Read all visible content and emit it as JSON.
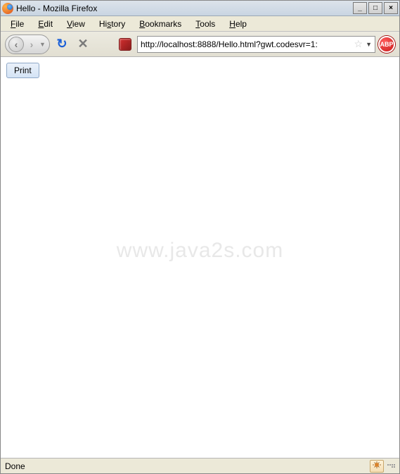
{
  "titlebar": {
    "title": "Hello - Mozilla Firefox"
  },
  "menu": {
    "file": "File",
    "edit": "Edit",
    "view": "View",
    "history": "History",
    "bookmarks": "Bookmarks",
    "tools": "Tools",
    "help": "Help"
  },
  "toolbar": {
    "url": "http://localhost:8888/Hello.html?gwt.codesvr=1:",
    "abp_label": "ABP"
  },
  "page": {
    "print_button": "Print",
    "watermark": "www.java2s.com"
  },
  "status": {
    "text": "Done"
  }
}
